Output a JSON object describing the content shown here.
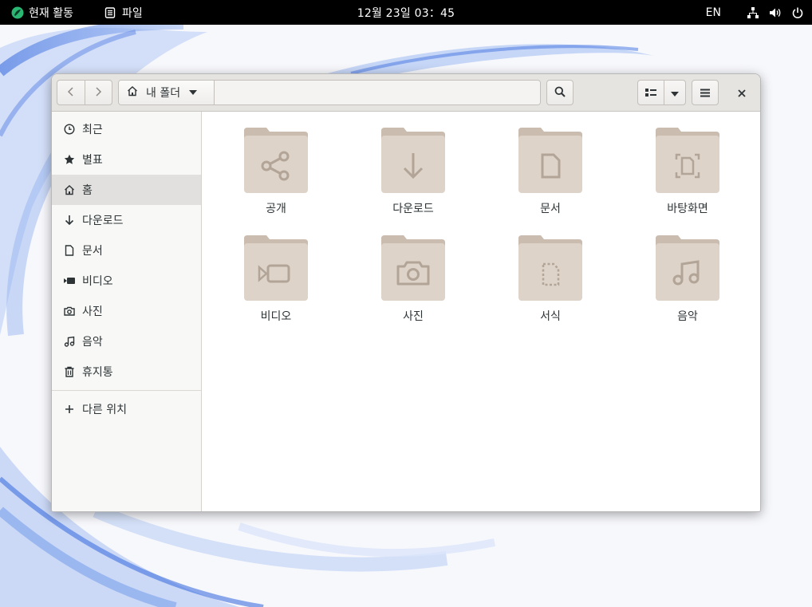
{
  "topbar": {
    "activities": "현재 활동",
    "app_name": "파일",
    "clock": "12월 23일  03：45",
    "lang": "EN",
    "icons": [
      "network-icon",
      "volume-icon",
      "power-icon"
    ]
  },
  "headerbar": {
    "path_label": "내 폴더",
    "icons": [
      "back-icon",
      "forward-icon",
      "home-icon",
      "path-dropdown-icon",
      "search-icon",
      "list-view-icon",
      "view-options-icon",
      "hamburger-menu-icon",
      "close-icon"
    ]
  },
  "sidebar": {
    "items": [
      {
        "label": "최근",
        "icon": "clock-icon"
      },
      {
        "label": "별표",
        "icon": "star-icon"
      },
      {
        "label": "홈",
        "icon": "home-icon"
      },
      {
        "label": "다운로드",
        "icon": "download-icon"
      },
      {
        "label": "문서",
        "icon": "document-icon"
      },
      {
        "label": "비디오",
        "icon": "video-icon"
      },
      {
        "label": "사진",
        "icon": "camera-icon"
      },
      {
        "label": "음악",
        "icon": "music-icon"
      },
      {
        "label": "휴지통",
        "icon": "trash-icon"
      }
    ],
    "other_locations": {
      "label": "다른 위치",
      "icon": "plus-icon"
    },
    "active_index": 2
  },
  "folders": [
    {
      "label": "공개",
      "icon": "share-icon"
    },
    {
      "label": "다운로드",
      "icon": "download-icon"
    },
    {
      "label": "문서",
      "icon": "document-icon"
    },
    {
      "label": "바탕화면",
      "icon": "desktop-icon"
    },
    {
      "label": "비디오",
      "icon": "video-icon"
    },
    {
      "label": "사진",
      "icon": "camera-icon"
    },
    {
      "label": "서식",
      "icon": "template-icon"
    },
    {
      "label": "음악",
      "icon": "music-icon"
    }
  ],
  "colors": {
    "folder": "#ddd3c9",
    "folder_tab": "#cabcae",
    "folder_symbol": "#b2a496",
    "topbar_bg": "#000000",
    "logo_green": "#2ab673"
  }
}
